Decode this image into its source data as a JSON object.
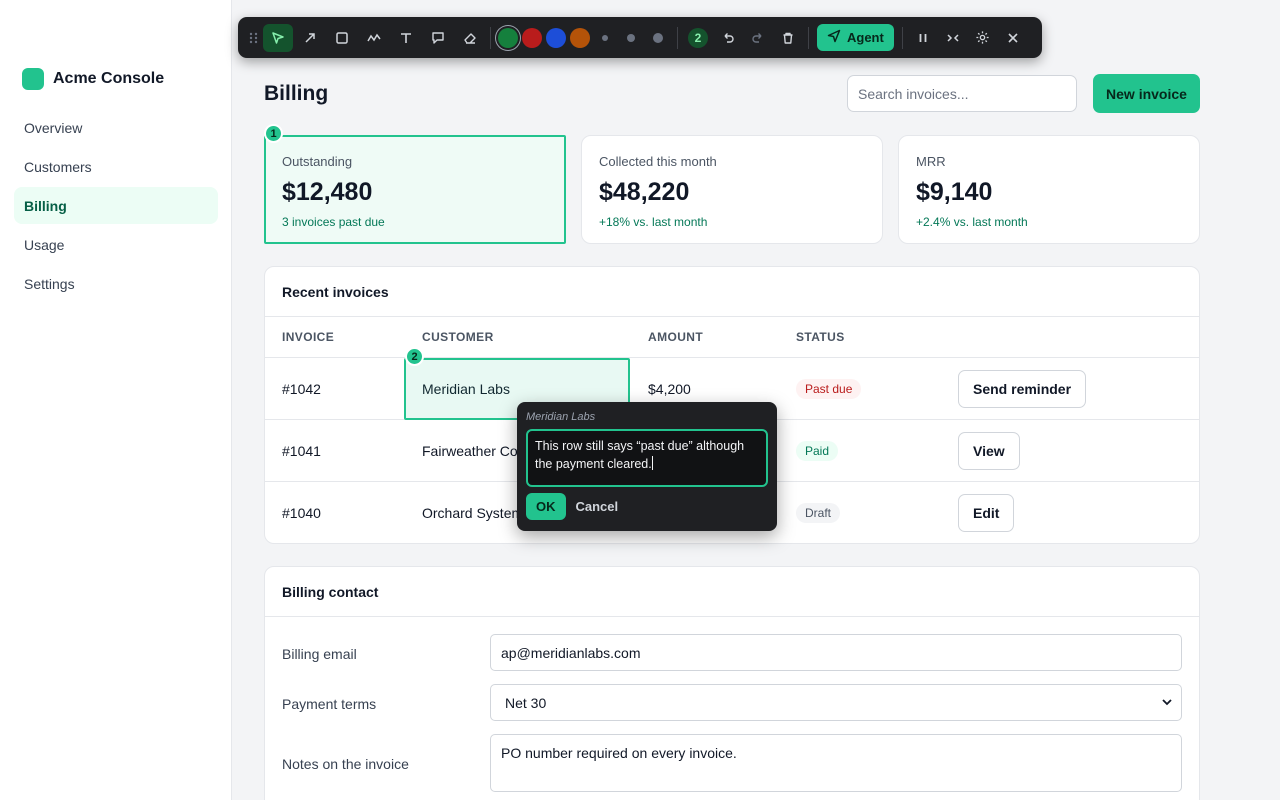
{
  "sidebar": {
    "brand": "Acme Console",
    "items": [
      {
        "label": "Overview"
      },
      {
        "label": "Customers"
      },
      {
        "label": "Billing",
        "active": true
      },
      {
        "label": "Usage"
      },
      {
        "label": "Settings"
      }
    ]
  },
  "header": {
    "title": "Billing",
    "search_placeholder": "Search invoices...",
    "new_invoice_label": "New invoice"
  },
  "stats": [
    {
      "label": "Outstanding",
      "value": "$12,480",
      "delta": "3 invoices past due",
      "badge": "1"
    },
    {
      "label": "Collected this month",
      "value": "$48,220",
      "delta": "+18% vs. last month"
    },
    {
      "label": "MRR",
      "value": "$9,140",
      "delta": "+2.4% vs. last month"
    }
  ],
  "invoices": {
    "title": "Recent invoices",
    "columns": [
      "INVOICE",
      "CUSTOMER",
      "AMOUNT",
      "STATUS"
    ],
    "rows": [
      {
        "invoice": "#1042",
        "customer": "Meridian Labs",
        "amount": "$4,200",
        "status": "Past due",
        "action": "Send reminder"
      },
      {
        "invoice": "#1041",
        "customer": "Fairweather Co.",
        "amount": "",
        "status": "Paid",
        "action": "View"
      },
      {
        "invoice": "#1040",
        "customer": "Orchard Systems",
        "amount": "",
        "status": "Draft",
        "action": "Edit"
      }
    ],
    "selection_badge": "2"
  },
  "billing_contact": {
    "title": "Billing contact",
    "email_label": "Billing email",
    "email_value": "ap@meridianlabs.com",
    "terms_label": "Payment terms",
    "terms_value": "Net 30",
    "notes_label": "Notes on the invoice",
    "notes_value": "PO number required on every invoice."
  },
  "toolbar": {
    "annotation_count": "2",
    "agent_label": "Agent",
    "colors": [
      "#15803d",
      "#b91c1c",
      "#1d4ed8",
      "#b45309"
    ]
  },
  "popover": {
    "title": "Meridian Labs",
    "text": "This row still says “past due” although the payment cleared.",
    "ok_label": "OK",
    "cancel_label": "Cancel"
  }
}
